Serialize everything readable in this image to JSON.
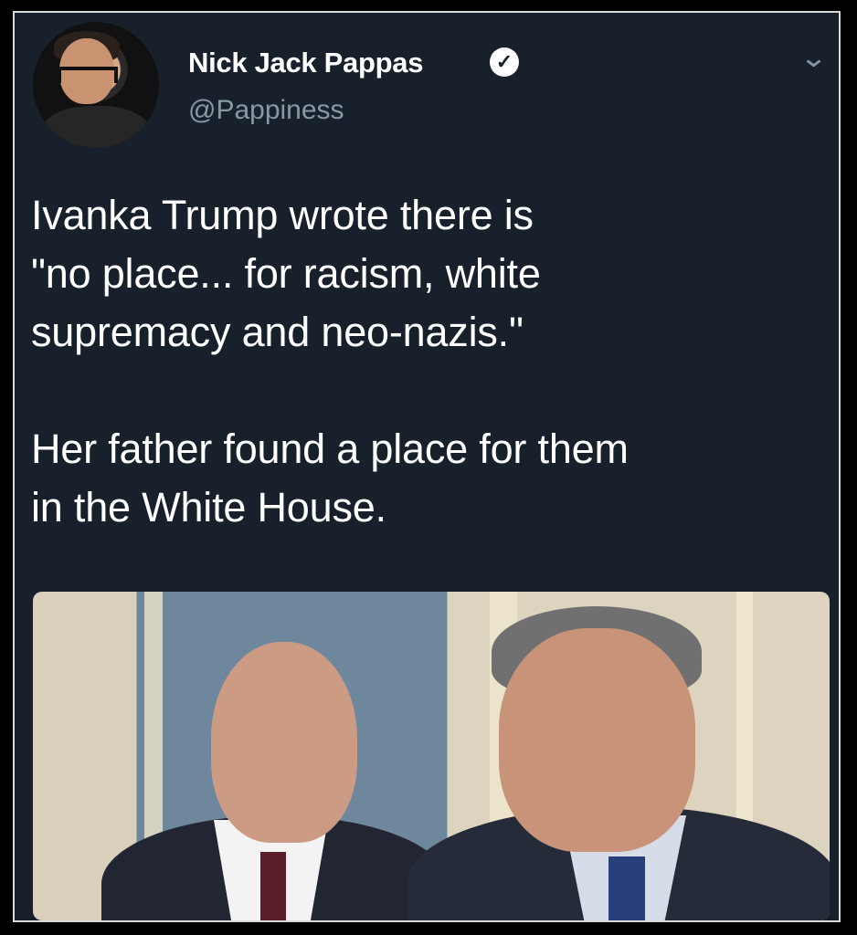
{
  "tweet": {
    "display_name": "Nick Jack Pappas",
    "handle": "@Pappiness",
    "text": "Ivanka Trump wrote there is\n\"no place... for racism, white\nsupremacy and neo-nazis.\"\n\nHer father found a place for them\nin the White House."
  },
  "icons": {
    "verified": "verified-badge-icon",
    "menu": "chevron-down-icon"
  },
  "colors": {
    "background": "#17202b",
    "text": "#ffffff",
    "muted": "#8899a6"
  }
}
